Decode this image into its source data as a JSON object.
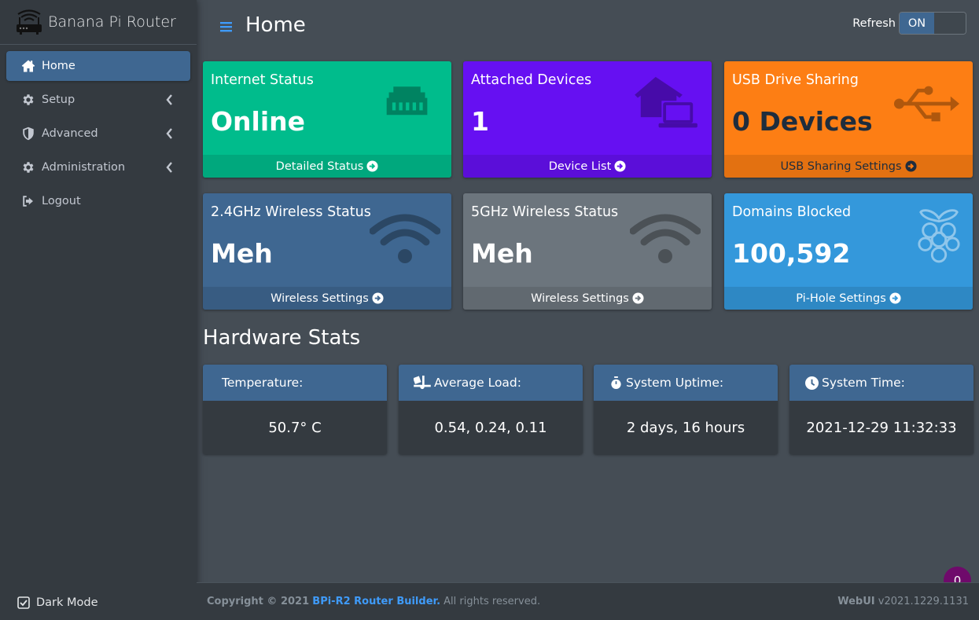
{
  "brand": {
    "title": "Banana Pi Router"
  },
  "sidebar": {
    "items": [
      {
        "label": "Home",
        "icon": "home-icon",
        "active": true
      },
      {
        "label": "Setup",
        "icon": "gear-icon"
      },
      {
        "label": "Advanced",
        "icon": "shield-icon"
      },
      {
        "label": "Administration",
        "icon": "gear-icon"
      },
      {
        "label": "Logout",
        "icon": "logout-icon"
      }
    ],
    "dark_mode_label": "Dark Mode"
  },
  "header": {
    "title": "Home",
    "refresh_label": "Refresh",
    "toggle_state": "ON"
  },
  "boxes": [
    {
      "label": "Internet Status",
      "value": "Online",
      "footer": "Detailed Status",
      "color": "#00bc8c",
      "icon": "ethernet-icon"
    },
    {
      "label": "Attached Devices",
      "value": "1",
      "footer": "Device List",
      "color": "#6610f2",
      "icon": "house-laptop-icon"
    },
    {
      "label": "USB Drive Sharing",
      "value": "0 Devices",
      "footer": "USB Sharing Settings",
      "color": "#fd7e14",
      "icon": "usb-icon"
    },
    {
      "label": "2.4GHz Wireless Status",
      "value": "Meh",
      "footer": "Wireless Settings",
      "color": "#3f6791",
      "icon": "wifi-icon"
    },
    {
      "label": "5GHz Wireless Status",
      "value": "Meh",
      "footer": "Wireless Settings",
      "color": "#6c757d",
      "icon": "wifi-icon"
    },
    {
      "label": "Domains Blocked",
      "value": "100,592",
      "footer": "Pi-Hole Settings",
      "color": "#3498db",
      "icon": "raspberry-icon"
    }
  ],
  "hardware": {
    "title": "Hardware Stats",
    "cards": [
      {
        "label": "Temperature:",
        "value": "50.7° C",
        "icon": "thermometer-icon"
      },
      {
        "label": "Average Load:",
        "value": "0.54, 0.24, 0.11",
        "icon": "truck-loading-icon"
      },
      {
        "label": "System Uptime:",
        "value": "2 days, 16 hours",
        "icon": "stopwatch-icon"
      },
      {
        "label": "System Time:",
        "value": "2021-12-29 11:32:33",
        "icon": "clock-icon"
      }
    ]
  },
  "footer": {
    "copyright": "Copyright © 2021",
    "link": "BPi-R2 Router Builder.",
    "rights": "All rights reserved.",
    "version_label": "WebUI",
    "version": "v2021.1229.1131"
  },
  "badge": {
    "count": "0"
  }
}
